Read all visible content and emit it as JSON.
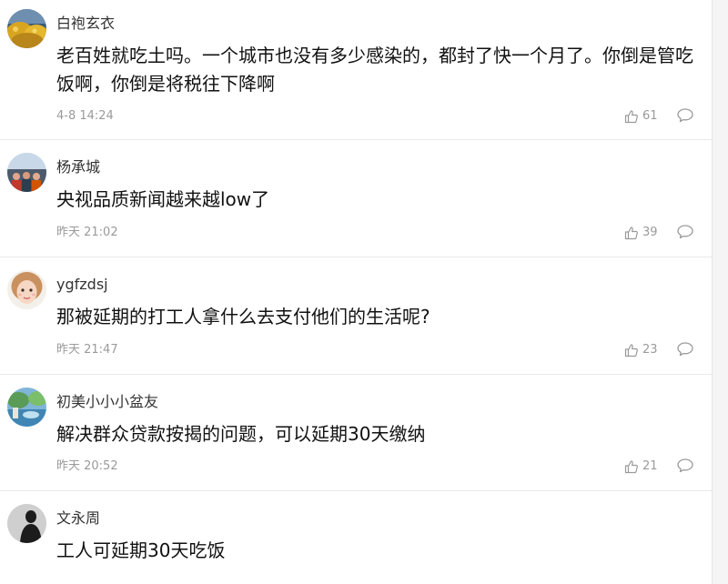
{
  "comments": [
    {
      "username": "白袍玄衣",
      "content": "老百姓就吃土吗。一个城市也没有多少感染的，都封了快一个月了。你倒是管吃饭啊，你倒是将税往下降啊",
      "time": "4-8 14:24",
      "likes": "61",
      "avatar_icon": "yellow-landscape-avatar-icon"
    },
    {
      "username": "杨承城",
      "content": "央视品质新闻越来越low了",
      "time": "昨天 21:02",
      "likes": "39",
      "avatar_icon": "group-photo-avatar-icon"
    },
    {
      "username": "ygfzdsj",
      "content": "那被延期的打工人拿什么去支付他们的生活呢?",
      "time": "昨天 21:47",
      "likes": "23",
      "avatar_icon": "girl-face-avatar-icon"
    },
    {
      "username": "初美小小小盆友",
      "content": "解决群众贷款按揭的问题，可以延期30天缴纳",
      "time": "昨天 20:52",
      "likes": "21",
      "avatar_icon": "scenic-photo-avatar-icon"
    },
    {
      "username": "文永周",
      "content": "工人可延期30天吃饭",
      "avatar_icon": "silhouette-avatar-icon"
    }
  ],
  "colors": {
    "meta_text": "#9a9a9a",
    "content_text": "#111111",
    "divider": "#e8e8e8"
  }
}
